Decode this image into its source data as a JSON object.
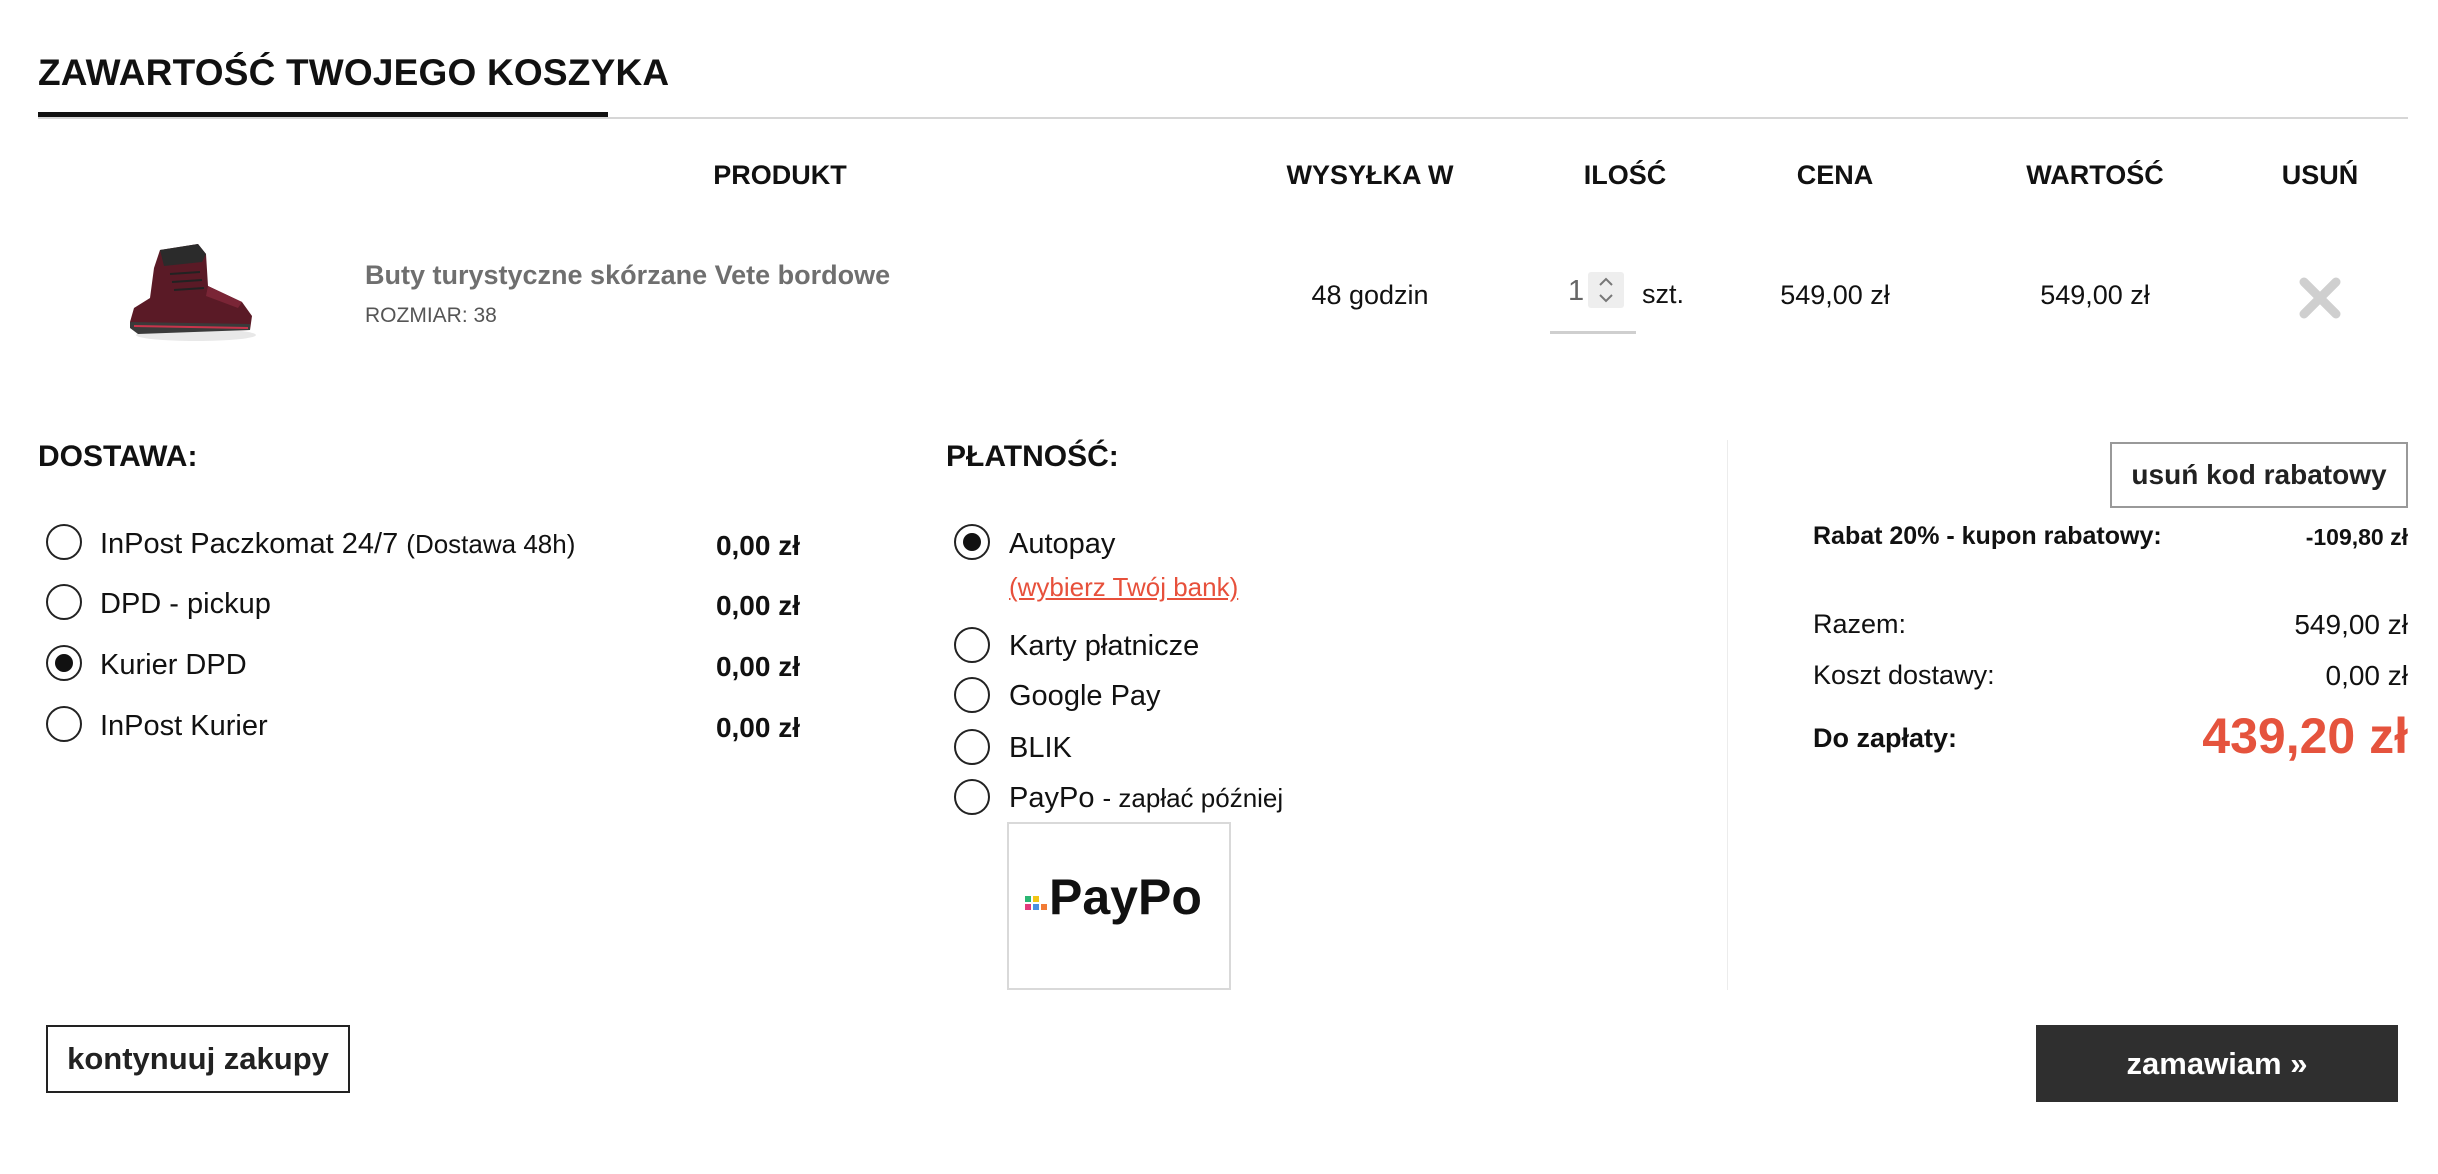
{
  "cart": {
    "title": "ZAWARTOŚĆ TWOJEGO KOSZYKA",
    "columns": {
      "product": "PRODUKT",
      "shipping_time": "WYSYŁKA W",
      "quantity": "ILOŚĆ",
      "price": "CENA",
      "value": "WARTOŚĆ",
      "remove": "USUŃ"
    },
    "item": {
      "name": "Buty turystyczne skórzane Vete bordowe",
      "size": "ROZMIAR: 38",
      "shipping_time": "48 godzin",
      "quantity": "1",
      "unit": "szt.",
      "price": "549,00 zł",
      "value": "549,00 zł",
      "image_icon": "hiking-boot-image",
      "remove_icon": "close-x-icon"
    }
  },
  "delivery": {
    "heading": "DOSTAWA:",
    "options": [
      {
        "label": "InPost Paczkomat 24/7",
        "note": "(Dostawa 48h)",
        "price": "0,00 zł",
        "selected": false
      },
      {
        "label": "DPD - pickup",
        "note": "",
        "price": "0,00 zł",
        "selected": false
      },
      {
        "label": "Kurier DPD",
        "note": "",
        "price": "0,00 zł",
        "selected": true
      },
      {
        "label": "InPost Kurier",
        "note": "",
        "price": "0,00 zł",
        "selected": false
      }
    ]
  },
  "payment": {
    "heading": "PŁATNOŚĆ:",
    "options": [
      {
        "label": "Autopay",
        "note": "",
        "selected": true
      },
      {
        "label": "Karty płatnicze",
        "note": "",
        "selected": false
      },
      {
        "label": "Google Pay",
        "note": "",
        "selected": false
      },
      {
        "label": "BLIK",
        "note": "",
        "selected": false
      },
      {
        "label": "PayPo",
        "note": "- zapłać później",
        "selected": false
      }
    ],
    "bank_link": "(wybierz Twój bank)",
    "paypo_logo_text": "PayPo"
  },
  "summary": {
    "remove_coupon": "usuń kod rabatowy",
    "discount_label": "Rabat 20% - kupon rabatowy:",
    "discount_value": "-109,80 zł",
    "subtotal_label": "Razem:",
    "subtotal_value": "549,00 zł",
    "shipping_label": "Koszt dostawy:",
    "shipping_value": "0,00 zł",
    "total_label": "Do zapłaty:",
    "total_value": "439,20 zł"
  },
  "footer": {
    "continue": "kontynuuj zakupy",
    "order": "zamawiam »"
  },
  "colors": {
    "accent_red": "#e5533d",
    "dark_button": "#2f2f2f"
  }
}
